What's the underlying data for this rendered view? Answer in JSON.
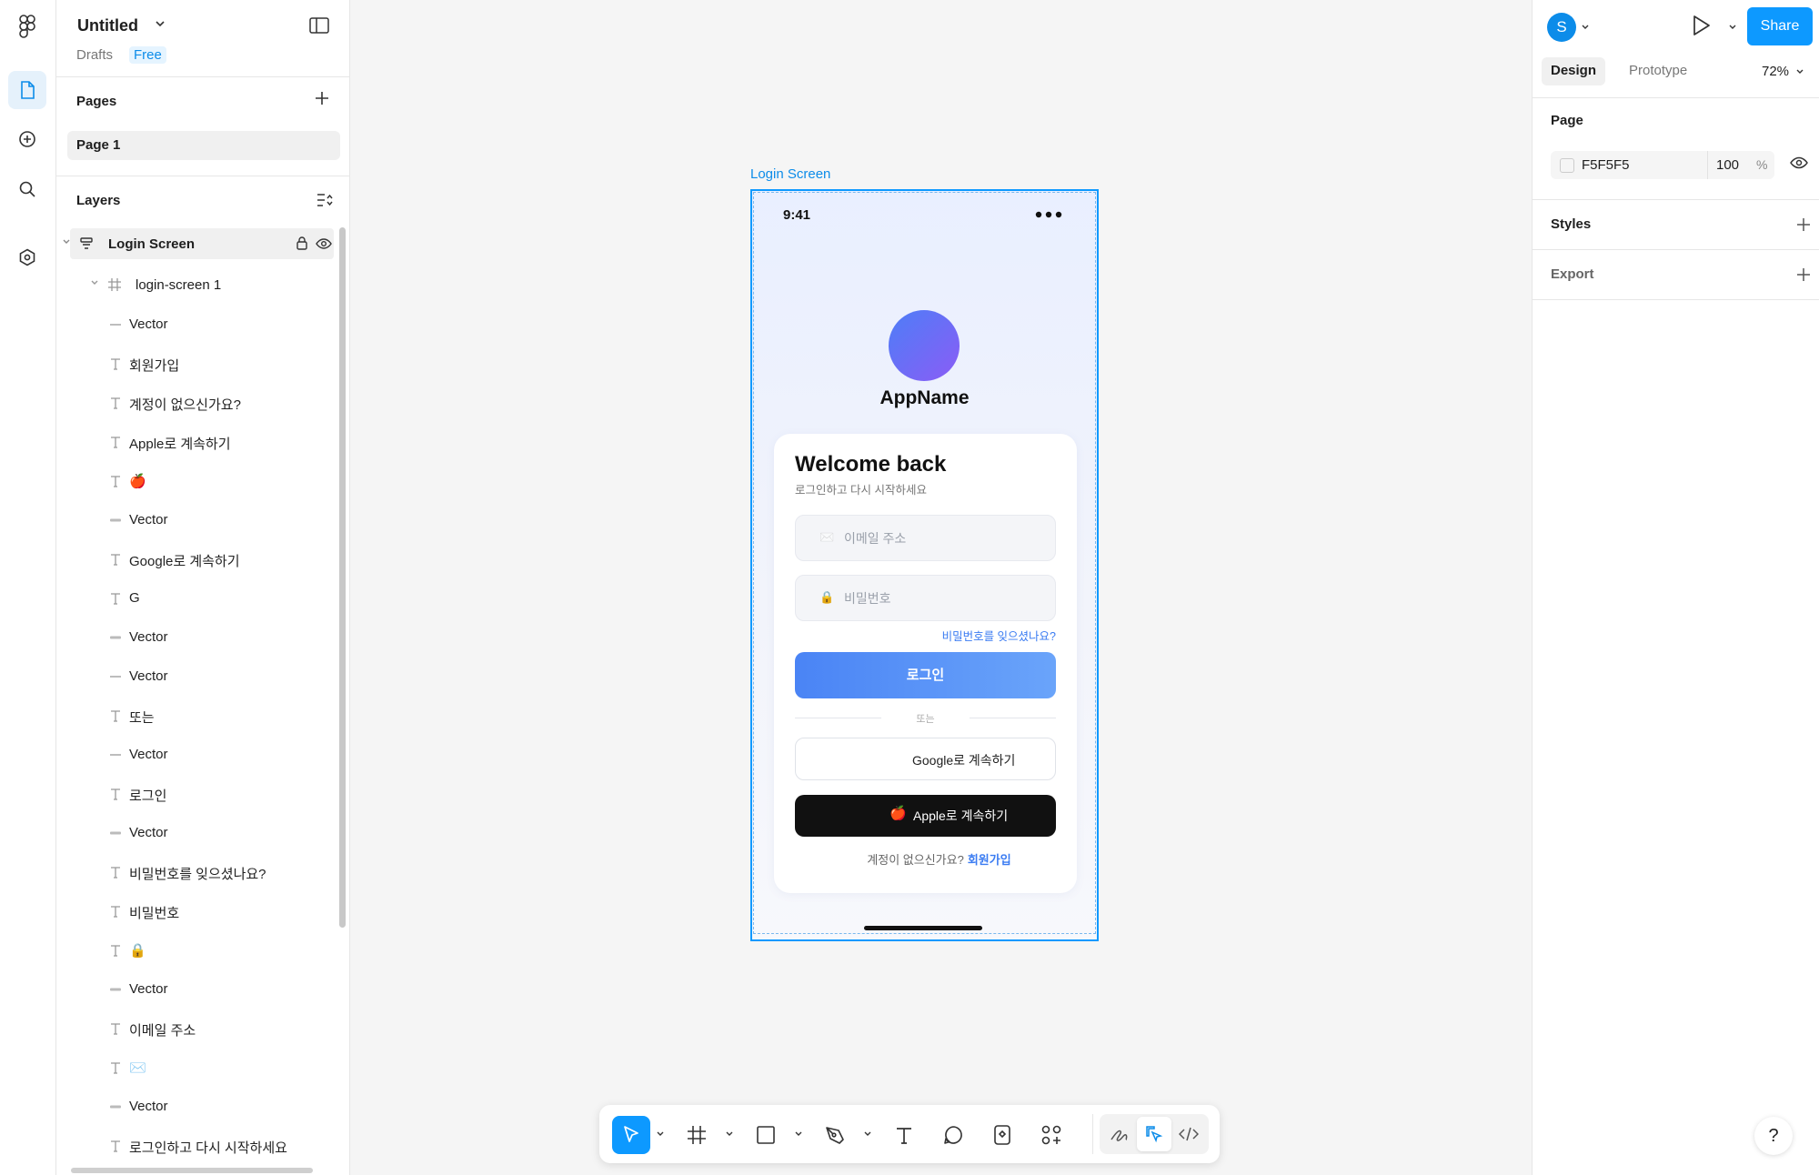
{
  "file": {
    "title": "Untitled",
    "location": "Drafts",
    "plan_badge": "Free"
  },
  "pages": {
    "title": "Pages",
    "items": [
      {
        "label": "Page 1"
      }
    ]
  },
  "layers": {
    "title": "Layers",
    "root": {
      "label": "Login Screen"
    },
    "child": {
      "label": "login-screen 1"
    },
    "items": [
      {
        "type": "line",
        "label": "Vector"
      },
      {
        "type": "text",
        "label": "회원가입"
      },
      {
        "type": "text",
        "label": "계정이 없으신가요?"
      },
      {
        "type": "text",
        "label": "Apple로 계속하기"
      },
      {
        "type": "text",
        "label": "🍎"
      },
      {
        "type": "rect",
        "label": "Vector"
      },
      {
        "type": "text",
        "label": "Google로 계속하기"
      },
      {
        "type": "text",
        "label": "G"
      },
      {
        "type": "rect",
        "label": "Vector"
      },
      {
        "type": "line",
        "label": "Vector"
      },
      {
        "type": "text",
        "label": "또는"
      },
      {
        "type": "line",
        "label": "Vector"
      },
      {
        "type": "text",
        "label": "로그인"
      },
      {
        "type": "rect",
        "label": "Vector"
      },
      {
        "type": "text",
        "label": "비밀번호를 잊으셨나요?"
      },
      {
        "type": "text",
        "label": "비밀번호"
      },
      {
        "type": "text",
        "label": "🔒"
      },
      {
        "type": "rect",
        "label": "Vector"
      },
      {
        "type": "text",
        "label": "이메일 주소"
      },
      {
        "type": "text",
        "label": "✉️"
      },
      {
        "type": "rect",
        "label": "Vector"
      },
      {
        "type": "text",
        "label": "로그인하고 다시 시작하세요"
      }
    ]
  },
  "canvas": {
    "frame_label": "Login Screen",
    "phone": {
      "status_time": "9:41",
      "app_name": "AppName",
      "welcome_title": "Welcome back",
      "welcome_subtitle": "로그인하고 다시 시작하세요",
      "email": {
        "icon": "✉️",
        "placeholder": "이메일 주소"
      },
      "password": {
        "icon": "🔒",
        "placeholder": "비밀번호"
      },
      "forgot_password": "비밀번호를 잊으셨나요?",
      "login_button": "로그인",
      "divider_text": "또는",
      "google_button": "Google로 계속하기",
      "apple_button": {
        "icon": "🍎",
        "label": "Apple로 계속하기"
      },
      "signup_prompt": "계정이 없으신가요?",
      "signup_link": "회원가입"
    }
  },
  "toolbar": {
    "tools": [
      "move-tool",
      "frame-tool",
      "shape-tool",
      "pen-tool",
      "text-tool",
      "comment-tool",
      "instance-tool",
      "actions-tool"
    ],
    "modes": [
      "draw-mode",
      "design-mode",
      "dev-mode"
    ]
  },
  "right_panel": {
    "user_initial": "S",
    "share_label": "Share",
    "tabs": [
      {
        "label": "Design"
      },
      {
        "label": "Prototype"
      }
    ],
    "zoom": "72%",
    "page_section": {
      "title": "Page",
      "color_hex": "F5F5F5",
      "opacity": "100",
      "opacity_unit": "%"
    },
    "styles_title": "Styles",
    "export_title": "Export",
    "help": "?"
  },
  "colors": {
    "accent": "#0d99ff",
    "selection": "#0d99ff",
    "canvas_bg": "#F5F5F5",
    "login_button": "#4a84f5",
    "apple_button": "#111111"
  }
}
